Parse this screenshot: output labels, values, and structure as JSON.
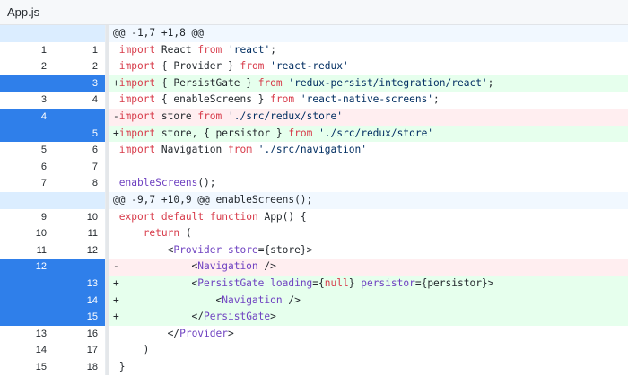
{
  "file": {
    "name": "App.js"
  },
  "rows": [
    {
      "type": "hunk",
      "old": "",
      "new": "",
      "tokens": [
        {
          "t": "@@ -1,7 +1,8 @@",
          "c": "plain"
        }
      ]
    },
    {
      "type": "ctx",
      "old": "1",
      "new": "1",
      "tokens": [
        {
          "t": " ",
          "c": "plain"
        },
        {
          "t": "import",
          "c": "kw"
        },
        {
          "t": " React ",
          "c": "plain"
        },
        {
          "t": "from",
          "c": "kw"
        },
        {
          "t": " ",
          "c": "plain"
        },
        {
          "t": "'react'",
          "c": "str"
        },
        {
          "t": ";",
          "c": "plain"
        }
      ]
    },
    {
      "type": "ctx",
      "old": "2",
      "new": "2",
      "tokens": [
        {
          "t": " ",
          "c": "plain"
        },
        {
          "t": "import",
          "c": "kw"
        },
        {
          "t": " { Provider } ",
          "c": "plain"
        },
        {
          "t": "from",
          "c": "kw"
        },
        {
          "t": " ",
          "c": "plain"
        },
        {
          "t": "'react-redux'",
          "c": "str"
        }
      ]
    },
    {
      "type": "add",
      "sel": "new",
      "old": "",
      "new": "3",
      "tokens": [
        {
          "t": "+",
          "c": "plain"
        },
        {
          "t": "import",
          "c": "kw"
        },
        {
          "t": " { PersistGate } ",
          "c": "plain"
        },
        {
          "t": "from",
          "c": "kw"
        },
        {
          "t": " ",
          "c": "plain"
        },
        {
          "t": "'redux-persist/integration/react'",
          "c": "str"
        },
        {
          "t": ";",
          "c": "plain"
        }
      ]
    },
    {
      "type": "ctx",
      "old": "3",
      "new": "4",
      "tokens": [
        {
          "t": " ",
          "c": "plain"
        },
        {
          "t": "import",
          "c": "kw"
        },
        {
          "t": " { enableScreens } ",
          "c": "plain"
        },
        {
          "t": "from",
          "c": "kw"
        },
        {
          "t": " ",
          "c": "plain"
        },
        {
          "t": "'react-native-screens'",
          "c": "str"
        },
        {
          "t": ";",
          "c": "plain"
        }
      ]
    },
    {
      "type": "del",
      "sel": "old",
      "old": "4",
      "new": "",
      "tokens": [
        {
          "t": "-",
          "c": "plain"
        },
        {
          "t": "import",
          "c": "kw"
        },
        {
          "t": " store ",
          "c": "plain"
        },
        {
          "t": "from",
          "c": "kw"
        },
        {
          "t": " ",
          "c": "plain"
        },
        {
          "t": "'./src/redux/store'",
          "c": "str"
        }
      ]
    },
    {
      "type": "add",
      "sel": "new",
      "old": "",
      "new": "5",
      "tokens": [
        {
          "t": "+",
          "c": "plain"
        },
        {
          "t": "import",
          "c": "kw"
        },
        {
          "t": " store, { persistor } ",
          "c": "plain"
        },
        {
          "t": "from",
          "c": "kw"
        },
        {
          "t": " ",
          "c": "plain"
        },
        {
          "t": "'./src/redux/store'",
          "c": "str"
        }
      ]
    },
    {
      "type": "ctx",
      "old": "5",
      "new": "6",
      "tokens": [
        {
          "t": " ",
          "c": "plain"
        },
        {
          "t": "import",
          "c": "kw"
        },
        {
          "t": " Navigation ",
          "c": "plain"
        },
        {
          "t": "from",
          "c": "kw"
        },
        {
          "t": " ",
          "c": "plain"
        },
        {
          "t": "'./src/navigation'",
          "c": "str"
        }
      ]
    },
    {
      "type": "ctx",
      "old": "6",
      "new": "7",
      "tokens": [
        {
          "t": "",
          "c": "plain"
        }
      ]
    },
    {
      "type": "ctx",
      "old": "7",
      "new": "8",
      "tokens": [
        {
          "t": " ",
          "c": "plain"
        },
        {
          "t": "enableScreens",
          "c": "fn"
        },
        {
          "t": "();",
          "c": "plain"
        }
      ]
    },
    {
      "type": "hunk",
      "old": "",
      "new": "",
      "tokens": [
        {
          "t": "@@ -9,7 +10,9 @@ enableScreens();",
          "c": "plain"
        }
      ]
    },
    {
      "type": "ctx",
      "old": "9",
      "new": "10",
      "tokens": [
        {
          "t": " ",
          "c": "plain"
        },
        {
          "t": "export",
          "c": "kw"
        },
        {
          "t": " ",
          "c": "plain"
        },
        {
          "t": "default",
          "c": "kw"
        },
        {
          "t": " ",
          "c": "plain"
        },
        {
          "t": "function",
          "c": "kw"
        },
        {
          "t": " App() {",
          "c": "plain"
        }
      ]
    },
    {
      "type": "ctx",
      "old": "10",
      "new": "11",
      "tokens": [
        {
          "t": "     ",
          "c": "plain"
        },
        {
          "t": "return",
          "c": "kw"
        },
        {
          "t": " (",
          "c": "plain"
        }
      ]
    },
    {
      "type": "ctx",
      "old": "11",
      "new": "12",
      "tokens": [
        {
          "t": "         <",
          "c": "plain"
        },
        {
          "t": "Provider",
          "c": "tag"
        },
        {
          "t": " ",
          "c": "plain"
        },
        {
          "t": "store",
          "c": "attr"
        },
        {
          "t": "={store}>",
          "c": "plain"
        }
      ]
    },
    {
      "type": "del",
      "sel": "old",
      "old": "12",
      "new": "",
      "tokens": [
        {
          "t": "-            <",
          "c": "plain"
        },
        {
          "t": "Navigation",
          "c": "tag"
        },
        {
          "t": " />",
          "c": "plain"
        }
      ]
    },
    {
      "type": "add",
      "sel": "new",
      "old": "",
      "new": "13",
      "tokens": [
        {
          "t": "+            <",
          "c": "plain"
        },
        {
          "t": "PersistGate",
          "c": "tag"
        },
        {
          "t": " ",
          "c": "plain"
        },
        {
          "t": "loading",
          "c": "attr"
        },
        {
          "t": "={",
          "c": "plain"
        },
        {
          "t": "null",
          "c": "kw"
        },
        {
          "t": "} ",
          "c": "plain"
        },
        {
          "t": "persistor",
          "c": "attr"
        },
        {
          "t": "={persistor}>",
          "c": "plain"
        }
      ]
    },
    {
      "type": "add",
      "sel": "new",
      "old": "",
      "new": "14",
      "tokens": [
        {
          "t": "+                <",
          "c": "plain"
        },
        {
          "t": "Navigation",
          "c": "tag"
        },
        {
          "t": " />",
          "c": "plain"
        }
      ]
    },
    {
      "type": "add",
      "sel": "new",
      "old": "",
      "new": "15",
      "tokens": [
        {
          "t": "+            </",
          "c": "plain"
        },
        {
          "t": "PersistGate",
          "c": "tag"
        },
        {
          "t": ">",
          "c": "plain"
        }
      ]
    },
    {
      "type": "ctx",
      "old": "13",
      "new": "16",
      "tokens": [
        {
          "t": "         </",
          "c": "plain"
        },
        {
          "t": "Provider",
          "c": "tag"
        },
        {
          "t": ">",
          "c": "plain"
        }
      ]
    },
    {
      "type": "ctx",
      "old": "14",
      "new": "17",
      "tokens": [
        {
          "t": "     )",
          "c": "plain"
        }
      ]
    },
    {
      "type": "ctx",
      "old": "15",
      "new": "18",
      "tokens": [
        {
          "t": " }",
          "c": "plain"
        }
      ]
    }
  ],
  "colors": {
    "add_bg": "#e6ffed",
    "del_bg": "#ffeef0",
    "hunk_bg": "#f1f8ff",
    "selected": "#2f7fea",
    "keyword": "#d73a49",
    "string": "#032f62",
    "tag": "#6f42c1"
  }
}
